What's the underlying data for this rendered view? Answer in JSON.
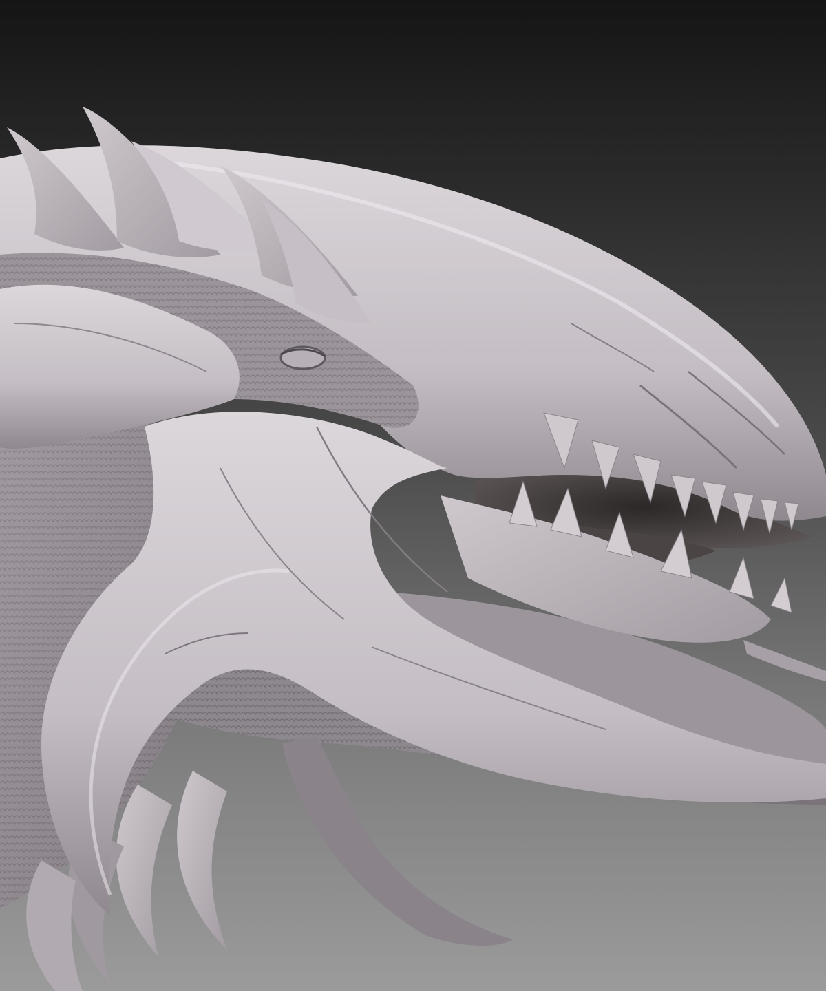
{
  "scene": {
    "subject_icon": "dragon-head-sculpt-icon",
    "colors": {
      "background_top": "#151515",
      "background_bottom": "#9b9b9b",
      "clay_light": "#d7d2d6",
      "clay_mid": "#b4aeb4",
      "clay_shadow": "#7d777d",
      "mouth_dark": "#3a3535",
      "fur_texture": "#8f8a8f"
    }
  }
}
